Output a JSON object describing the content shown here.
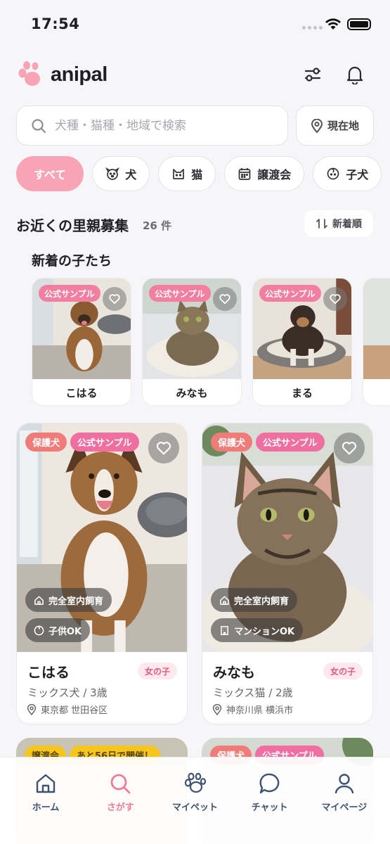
{
  "status_bar": {
    "time": "17:54"
  },
  "header": {
    "app_name": "anipal",
    "brand_color": "#f7a5b6"
  },
  "search": {
    "placeholder": "犬種・猫種・地域で検索",
    "location_button": "現在地"
  },
  "filters": [
    {
      "label": "すべて",
      "icon": "",
      "active": true
    },
    {
      "label": "犬",
      "icon": "dog-icon"
    },
    {
      "label": "猫",
      "icon": "cat-icon"
    },
    {
      "label": "譲渡会",
      "icon": "calendar-icon"
    },
    {
      "label": "子犬",
      "icon": "puppy-icon"
    }
  ],
  "section": {
    "title": "お近くの里親募集",
    "count": "26 件",
    "sort_label": "新着順"
  },
  "new_arrivals": {
    "title": "新着の子たち",
    "items": [
      {
        "name": "こはる",
        "tag": "公式サンプル"
      },
      {
        "name": "みなも",
        "tag": "公式サンプル"
      },
      {
        "name": "まる",
        "tag": "公式サンプル"
      }
    ]
  },
  "listings": [
    {
      "badges": [
        "保護犬",
        "公式サンプル"
      ],
      "features": [
        "完全室内飼育",
        "子供OK"
      ],
      "name": "こはる",
      "sex": "女の子",
      "breed": "ミックス犬 / 3歳",
      "location": "東京都 世田谷区"
    },
    {
      "badges": [
        "保護犬",
        "公式サンプル"
      ],
      "features": [
        "完全室内飼育",
        "マンションOK"
      ],
      "name": "みなも",
      "sex": "女の子",
      "breed": "ミックス猫 / 2歳",
      "location": "神奈川県 横浜市"
    }
  ],
  "peek_cards": [
    {
      "badges": [
        "譲渡会",
        "あと56日で開催！"
      ]
    },
    {
      "badges": [
        "保護犬",
        "公式サンプル"
      ]
    }
  ],
  "tab_bar": [
    {
      "label": "ホーム",
      "icon": "home-icon"
    },
    {
      "label": "さがす",
      "icon": "search-icon",
      "active": true
    },
    {
      "label": "マイペット",
      "icon": "paw-icon"
    },
    {
      "label": "チャット",
      "icon": "chat-icon"
    },
    {
      "label": "マイページ",
      "icon": "user-icon"
    }
  ]
}
